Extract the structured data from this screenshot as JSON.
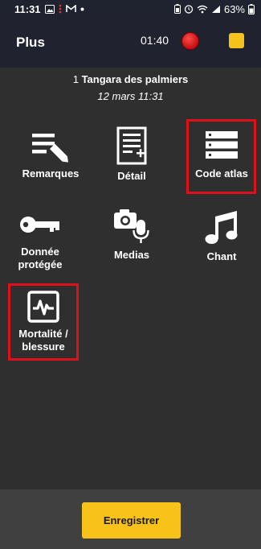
{
  "status_bar": {
    "time": "11:31",
    "battery": "63%"
  },
  "header": {
    "title": "Plus",
    "timer": "01:40"
  },
  "observation": {
    "count": "1",
    "species": "Tangara des palmiers",
    "datetime": "12 mars 11:31"
  },
  "actions": [
    {
      "label": "Remarques",
      "icon": "edit-notes-icon"
    },
    {
      "label": "Détail",
      "icon": "document-add-icon"
    },
    {
      "label": "Code atlas",
      "icon": "list-icon"
    },
    {
      "label": "Donnée protégée",
      "icon": "key-icon"
    },
    {
      "label": "Medias",
      "icon": "camera-mic-icon"
    },
    {
      "label": "Chant",
      "icon": "music-note-icon"
    },
    {
      "label": "Mortalité / blessure",
      "icon": "heartbeat-monitor-icon"
    }
  ],
  "footer": {
    "save_label": "Enregistrer"
  },
  "colors": {
    "accent": "#f7c21a",
    "record": "#d81b1f",
    "highlight": "#e0101a"
  }
}
